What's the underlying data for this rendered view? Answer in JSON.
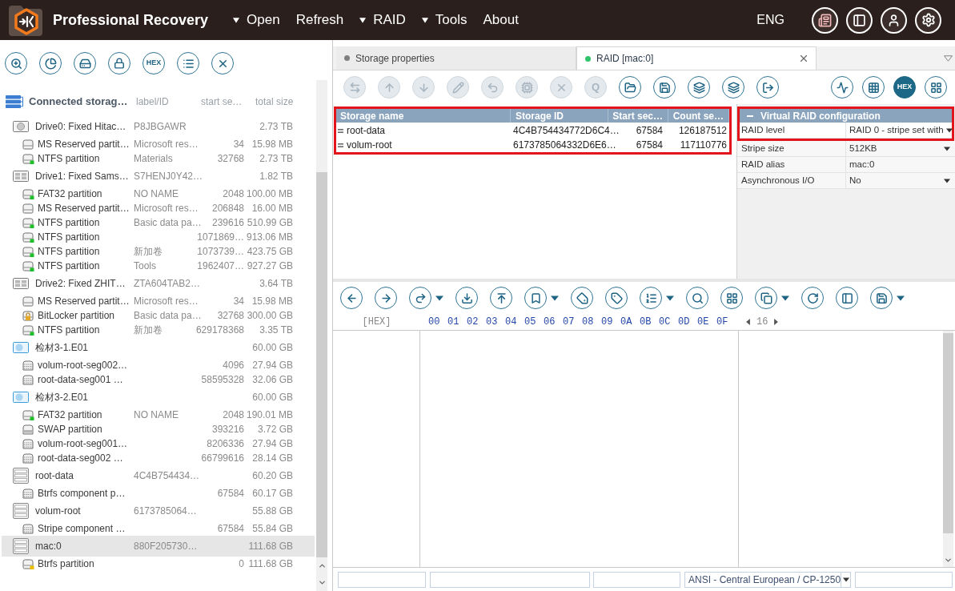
{
  "app": {
    "title": "Professional Recovery"
  },
  "menu": [
    {
      "label": "Open",
      "dropdown": true
    },
    {
      "label": "Refresh",
      "dropdown": false
    },
    {
      "label": "RAID",
      "dropdown": true
    },
    {
      "label": "Tools",
      "dropdown": true
    },
    {
      "label": "About",
      "dropdown": false
    }
  ],
  "language": "ENG",
  "left_toolbar": {
    "hex_label": "HEX"
  },
  "tree": {
    "columns": [
      "Connected storag…",
      "label/ID",
      "start se…",
      "total size"
    ],
    "items": [
      {
        "name": "Drive0: Fixed Hitac…",
        "label": "P8JBGAWR",
        "size": "2.73 TB",
        "kind": "hdd",
        "selected": false,
        "children": [
          {
            "name": "MS Reserved partit…",
            "label": "Microsoft res…",
            "start": "34",
            "size": "15.98 MB",
            "kind": "plain",
            "selected": false
          },
          {
            "name": "NTFS partition",
            "label": "Materials",
            "start": "32768",
            "size": "2.73 TB",
            "kind": "ok",
            "selected": false
          }
        ]
      },
      {
        "name": "Drive1: Fixed Sams…",
        "label": "S7HENJ0Y42…",
        "size": "1.82 TB",
        "kind": "disk",
        "selected": false,
        "children": [
          {
            "name": "FAT32 partition",
            "label": "NO NAME",
            "start": "2048",
            "size": "100.00 MB",
            "kind": "ok",
            "selected": false
          },
          {
            "name": "MS Reserved partit…",
            "label": "Microsoft res…",
            "start": "206848",
            "size": "16.00 MB",
            "kind": "plain",
            "selected": false
          },
          {
            "name": "NTFS partition",
            "label": "Basic data pa…",
            "start": "239616",
            "size": "510.99 GB",
            "kind": "ok",
            "selected": false
          },
          {
            "name": "NTFS partition",
            "start": "1071869…",
            "size": "913.06 MB",
            "kind": "ok",
            "selected": false
          },
          {
            "name": "NTFS partition",
            "label": "新加卷",
            "start": "1073739…",
            "size": "423.75 GB",
            "kind": "ok",
            "selected": false
          },
          {
            "name": "NTFS partition",
            "label": "Tools",
            "start": "1962407…",
            "size": "927.27 GB",
            "kind": "ok",
            "selected": false
          }
        ]
      },
      {
        "name": "Drive2: Fixed ZHIT…",
        "label": "ZTA604TAB2…",
        "size": "3.64 TB",
        "kind": "disk",
        "selected": false,
        "children": [
          {
            "name": "MS Reserved partit…",
            "label": "Microsoft res…",
            "start": "34",
            "size": "15.98 MB",
            "kind": "plain",
            "selected": false
          },
          {
            "name": "BitLocker partition",
            "label": "Basic data pa…",
            "start": "32768",
            "size": "300.00 GB",
            "kind": "locked",
            "selected": false
          },
          {
            "name": "NTFS partition",
            "label": "新加卷",
            "start": "629178368",
            "size": "3.35 TB",
            "kind": "ok",
            "selected": false
          }
        ]
      },
      {
        "name": "检材3-1.E01",
        "size": "60.00 GB",
        "kind": "image",
        "selected": false,
        "children": [
          {
            "name": "volum-root-seg002…",
            "start": "4096",
            "size": "27.94 GB",
            "kind": "segment",
            "selected": false
          },
          {
            "name": "root-data-seg001 …",
            "start": "58595328",
            "size": "32.06 GB",
            "kind": "segment",
            "selected": false
          }
        ]
      },
      {
        "name": "检材3-2.E01",
        "size": "60.00 GB",
        "kind": "image",
        "selected": false,
        "children": [
          {
            "name": "FAT32 partition",
            "label": "NO NAME",
            "start": "2048",
            "size": "190.01 MB",
            "kind": "ok",
            "selected": false
          },
          {
            "name": "SWAP partition",
            "start": "393216",
            "size": "3.72 GB",
            "kind": "swap",
            "selected": false
          },
          {
            "name": "volum-root-seg001…",
            "start": "8206336",
            "size": "27.94 GB",
            "kind": "segment",
            "selected": false
          },
          {
            "name": "root-data-seg002 …",
            "start": "66799616",
            "size": "28.14 GB",
            "kind": "segment",
            "selected": false
          }
        ]
      },
      {
        "name": "root-data",
        "label": "4C4B754434…",
        "size": "60.20 GB",
        "kind": "raid",
        "selected": false,
        "children": [
          {
            "name": "Btrfs component p…",
            "start": "67584",
            "size": "60.17 GB",
            "kind": "segment",
            "selected": false
          }
        ]
      },
      {
        "name": "volum-root",
        "label": "6173785064…",
        "size": "55.88 GB",
        "kind": "raid",
        "selected": false,
        "children": [
          {
            "name": "Stripe component …",
            "start": "67584",
            "size": "55.84 GB",
            "kind": "segment",
            "selected": false
          }
        ]
      },
      {
        "name": "mac:0",
        "label": "880F205730…",
        "size": "111.68 GB",
        "kind": "raid",
        "selected": true,
        "children": [
          {
            "name": "Btrfs partition",
            "start": "0",
            "size": "111.68 GB",
            "kind": "warn",
            "selected": false
          }
        ]
      }
    ]
  },
  "tabs": [
    {
      "label": "Storage properties",
      "selected": false,
      "color": "#7f7f7f"
    },
    {
      "label": "RAID [mac:0]",
      "selected": true,
      "color": "#2fc46b"
    }
  ],
  "storage_toolbar": {
    "buttons": [
      {
        "disabled": true
      },
      {
        "disabled": true
      },
      {
        "disabled": true
      },
      {
        "disabled": true
      },
      {
        "disabled": true
      },
      {
        "disabled": true
      },
      {
        "disabled": true
      },
      {
        "label": "Q",
        "disabled": true
      },
      {
        "disabled": false
      },
      {
        "disabled": false
      },
      {
        "disabled": false
      },
      {
        "disabled": false
      },
      {
        "disabled": false
      }
    ],
    "view_buttons": [
      {
        "selected": false
      },
      {
        "selected": false
      },
      {
        "label": "HEX",
        "selected": true
      },
      {
        "selected": false
      }
    ]
  },
  "raid_members": {
    "highlighted": true,
    "columns": [
      "Storage name",
      "Storage ID",
      "Start sec…",
      "Count se…"
    ],
    "rows": [
      {
        "name": "root-data",
        "id": "4C4B754434772D6C4…",
        "start": "67584",
        "count": "126187512"
      },
      {
        "name": "volum-root",
        "id": "6173785064332D6E6…",
        "start": "67584",
        "count": "117110776"
      }
    ]
  },
  "raid_config": {
    "title": "Virtual RAID configuration",
    "expanded": true,
    "highlighted": true,
    "rows": [
      {
        "label": "RAID level",
        "value": "RAID 0 - stripe set with",
        "dropdown": true
      },
      {
        "label": "Stripe size",
        "value": "512KB",
        "dropdown": true
      },
      {
        "label": "RAID alias",
        "value": "mac:0",
        "dropdown": false
      },
      {
        "label": "Asynchronous I/O",
        "value": "No",
        "dropdown": true
      }
    ]
  },
  "hex_view": {
    "offset_label": "[HEX]",
    "columns": [
      "00",
      "01",
      "02",
      "03",
      "04",
      "05",
      "06",
      "07",
      "08",
      "09",
      "0A",
      "0B",
      "0C",
      "0D",
      "0E",
      "0F"
    ],
    "bytes_per_row": "16"
  },
  "status_bar": {
    "encoding": "ANSI - Central European / CP-1250"
  }
}
